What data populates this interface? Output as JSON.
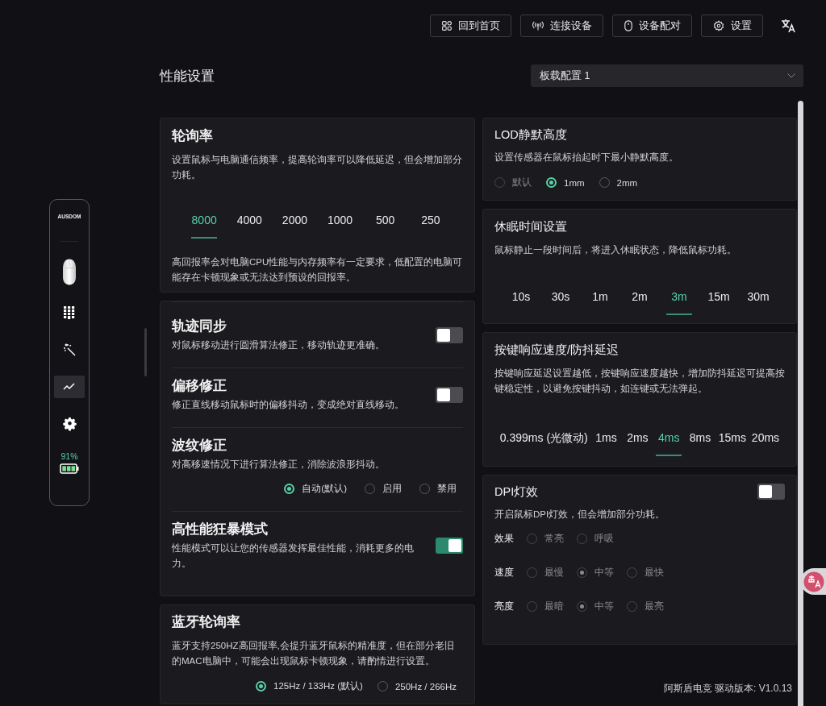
{
  "top_bar": {
    "buttons": [
      {
        "label": "回到首页"
      },
      {
        "label": "连接设备"
      },
      {
        "label": "设备配对"
      },
      {
        "label": "设置"
      }
    ]
  },
  "sidebar": {
    "logo": "AUSDOM",
    "items": [
      {
        "selected": false
      },
      {
        "selected": false
      },
      {
        "selected": true
      },
      {
        "selected": false
      }
    ],
    "battery_reading": "91%"
  },
  "page": {
    "title": "性能设置",
    "profile_select": {
      "value": "板载配置 1"
    }
  },
  "left_column": [
    {
      "kind": "segmented",
      "title": "轮询率",
      "description": "设置鼠标与电脑通信频率，提高轮询率可以降低延迟，但会增加部分功耗。",
      "options": [
        {
          "label": "8000",
          "selected": true
        },
        {
          "label": "4000",
          "selected": false
        },
        {
          "label": "2000",
          "selected": false
        },
        {
          "label": "1000",
          "selected": false
        },
        {
          "label": "500",
          "selected": false
        },
        {
          "label": "250",
          "selected": false
        }
      ],
      "note": "高回报率会对电脑CPU性能与内存频率有一定要求，低配置的电脑可能存在卡顿现象或无法达到预设的回报率。"
    },
    {
      "kind": "group",
      "items": [
        {
          "kind": "toggle",
          "title": "轨迹同步",
          "description": "对鼠标移动进行圆滑算法修正，移动轨迹更准确。",
          "on": false
        },
        {
          "kind": "toggle",
          "title": "偏移修正",
          "description": "修正直线移动鼠标时的偏移抖动，变成绝对直线移动。",
          "on": false
        },
        {
          "kind": "radio",
          "title": "波纹修正",
          "description": "对高移速情况下进行算法修正，消除波浪形抖动。",
          "options": [
            {
              "label": "自动(默认)",
              "selected": true
            },
            {
              "label": "启用",
              "selected": false
            },
            {
              "label": "禁用",
              "selected": false
            }
          ]
        },
        {
          "kind": "toggle",
          "title": "高性能狂暴模式",
          "description": "性能模式可以让您的传感器发挥最佳性能，消耗更多的电力。",
          "on": true
        }
      ]
    },
    {
      "kind": "radio",
      "title": "蓝牙轮询率",
      "description": "蓝牙支持250HZ高回报率,会提升蓝牙鼠标的精准度，但在部分老旧的MAC电脑中，可能会出现鼠标卡顿现象，请酌情进行设置。",
      "options": [
        {
          "label": "125Hz / 133Hz (默认)",
          "selected": true
        },
        {
          "label": "250Hz / 266Hz",
          "selected": false
        }
      ]
    }
  ],
  "right_column": [
    {
      "kind": "radio",
      "title": "LOD静默高度",
      "description": "设置传感器在鼠标抬起时下最小静默高度。",
      "options": [
        {
          "label": "默认",
          "selected": false,
          "disabled": true
        },
        {
          "label": "1mm",
          "selected": true,
          "disabled": false
        },
        {
          "label": "2mm",
          "selected": false,
          "disabled": false
        }
      ]
    },
    {
      "kind": "segmented",
      "title": "休眠时间设置",
      "description": "鼠标静止一段时间后，将进入休眠状态，降低鼠标功耗。",
      "options": [
        {
          "label": "10s",
          "selected": false
        },
        {
          "label": "30s",
          "selected": false
        },
        {
          "label": "1m",
          "selected": false
        },
        {
          "label": "2m",
          "selected": false
        },
        {
          "label": "3m",
          "selected": true
        },
        {
          "label": "15m",
          "selected": false
        },
        {
          "label": "30m",
          "selected": false
        }
      ]
    },
    {
      "kind": "segmented",
      "title": "按键响应速度/防抖延迟",
      "description": "按键响应延迟设置越低，按键响应速度越快，增加防抖延迟可提高按键稳定性，以避免按键抖动，如连键或无法弹起。",
      "options": [
        {
          "label": "0.399ms (光微动)",
          "selected": false
        },
        {
          "label": "1ms",
          "selected": false
        },
        {
          "label": "2ms",
          "selected": false
        },
        {
          "label": "4ms",
          "selected": true
        },
        {
          "label": "8ms",
          "selected": false
        },
        {
          "label": "15ms",
          "selected": false
        },
        {
          "label": "20ms",
          "selected": false
        }
      ]
    },
    {
      "kind": "dpi",
      "title": "DPI灯效",
      "on": false,
      "description": "开启鼠标DPI灯效，但会增加部分功耗。",
      "rows": [
        {
          "label": "效果",
          "options": [
            {
              "label": "常亮",
              "selected": false
            },
            {
              "label": "呼吸",
              "selected": false
            }
          ]
        },
        {
          "label": "速度",
          "options": [
            {
              "label": "最慢",
              "selected": false
            },
            {
              "label": "中等",
              "selected": true
            },
            {
              "label": "最快",
              "selected": false
            }
          ]
        },
        {
          "label": "亮度",
          "options": [
            {
              "label": "最暗",
              "selected": false
            },
            {
              "label": "中等",
              "selected": true
            },
            {
              "label": "最亮",
              "selected": false
            }
          ]
        }
      ]
    }
  ],
  "footer": {
    "version": "阿斯盾电竞 驱动版本: V1.0.13"
  }
}
